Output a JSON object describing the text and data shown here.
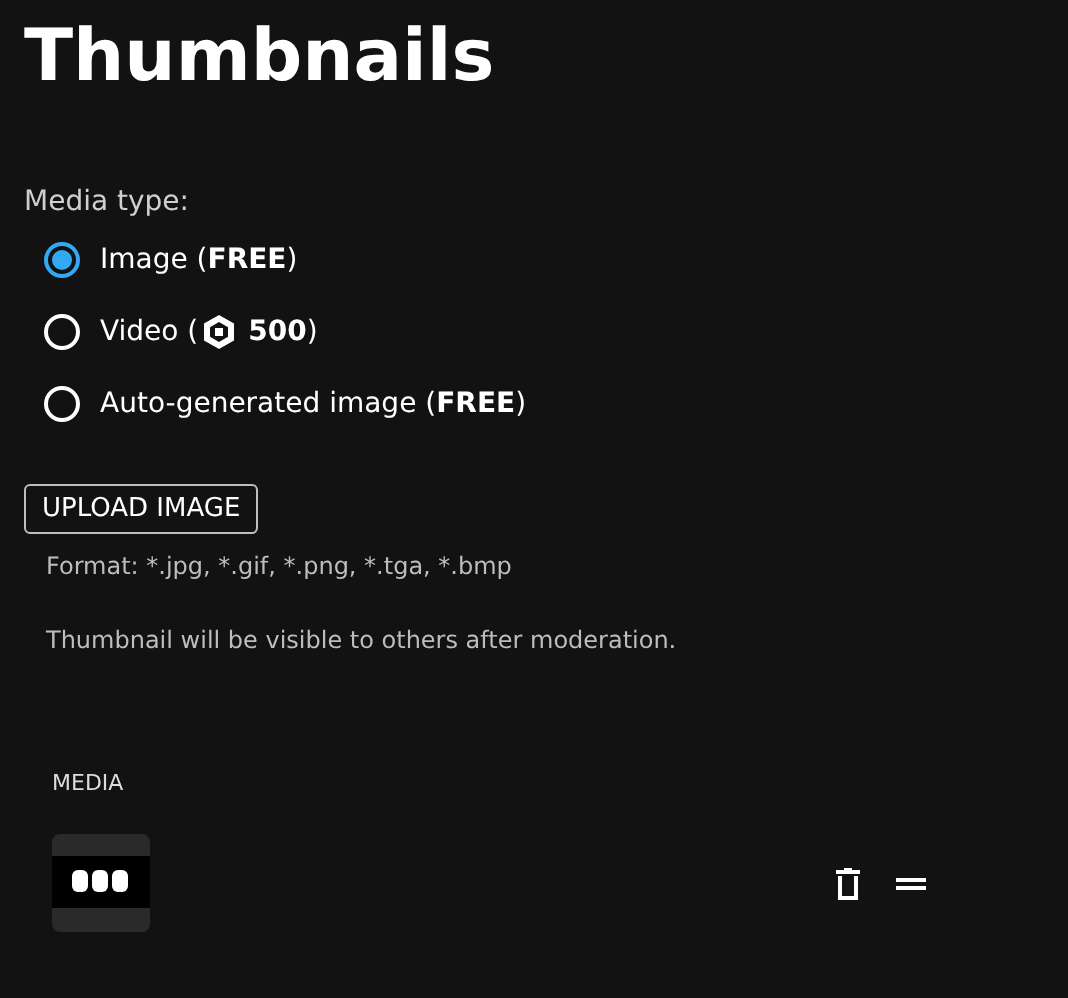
{
  "title": "Thumbnails",
  "media_type": {
    "label": "Media type:",
    "options": [
      {
        "kind": "text",
        "label": "Image (**FREE**)",
        "selected": true
      },
      {
        "kind": "price",
        "label": "Video (",
        "price": "500",
        "suffix": ")",
        "selected": false
      },
      {
        "kind": "text",
        "label": "Auto-generated image (**FREE**)",
        "selected": false
      }
    ]
  },
  "upload_button": "UPLOAD IMAGE",
  "format_note": "Format: *.jpg, *.gif, *.png, *.tga, *.bmp",
  "moderation_note": "Thumbnail will be visible to others after moderation.",
  "media": {
    "heading": "MEDIA"
  }
}
